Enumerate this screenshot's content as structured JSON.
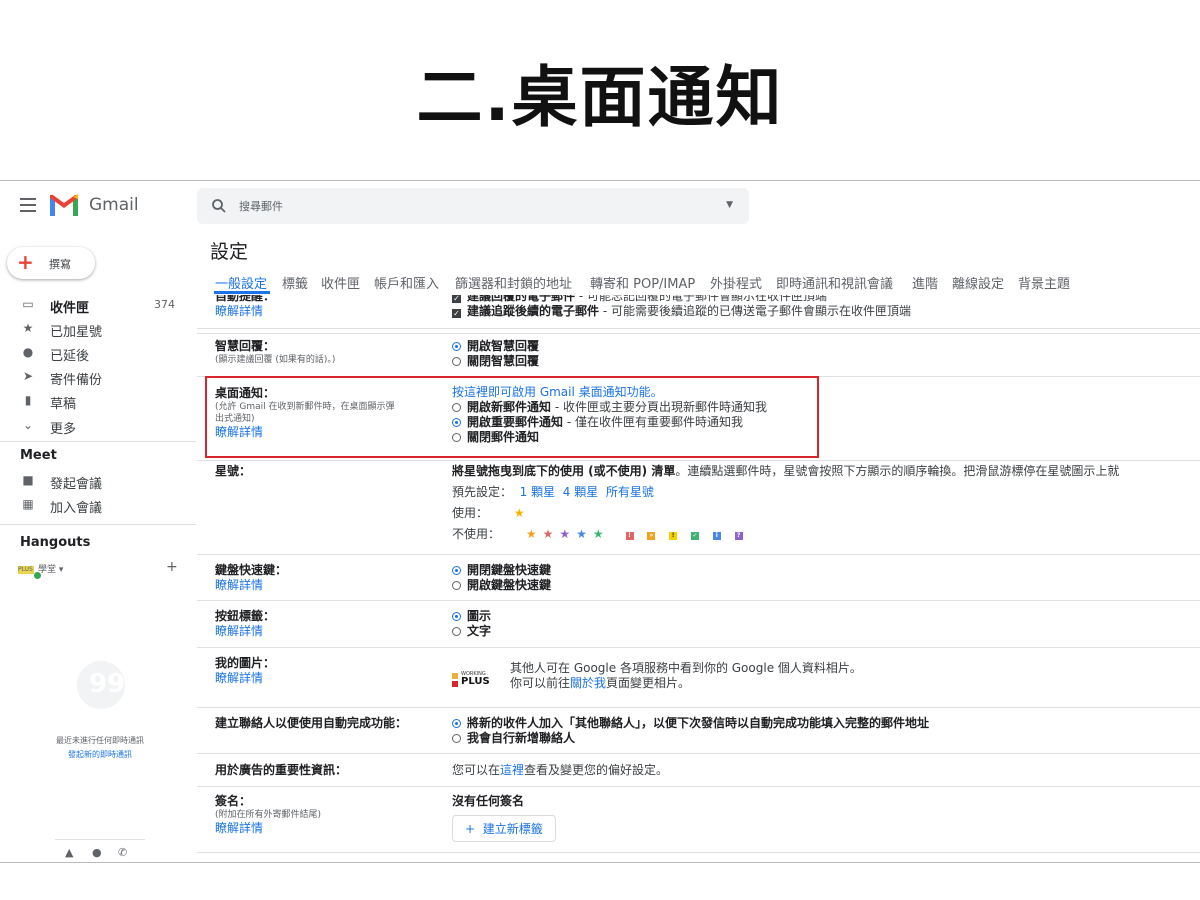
{
  "slide": {
    "title": "二.桌面通知"
  },
  "header": {
    "app_name": "Gmail",
    "search_placeholder": "搜尋郵件"
  },
  "sidebar": {
    "compose_label": "撰寫",
    "items": [
      {
        "label": "收件匣",
        "count": "374",
        "icon": "inbox-icon"
      },
      {
        "label": "已加星號",
        "icon": "star-icon"
      },
      {
        "label": "已延後",
        "icon": "clock-icon"
      },
      {
        "label": "寄件備份",
        "icon": "send-icon"
      },
      {
        "label": "草稿",
        "icon": "draft-icon"
      },
      {
        "label": "更多",
        "icon": "chevron-down-icon"
      }
    ],
    "meet": {
      "heading": "Meet",
      "items": [
        {
          "label": "發起會議"
        },
        {
          "label": "加入會議"
        }
      ]
    },
    "hangouts": {
      "heading": "Hangouts",
      "user": "學堂",
      "avatar_text": "PLUS",
      "empty_text": "最近未進行任何即時通訊",
      "start_link": "發起新的即時通訊"
    }
  },
  "settings": {
    "title": "設定",
    "tabs": [
      "一般設定",
      "標籤",
      "收件匣",
      "帳戶和匯入",
      "篩選器和封鎖的地址",
      "轉寄和 POP/IMAP",
      "外掛程式",
      "即時通訊和視訊會議",
      "進階",
      "離線設定",
      "背景主題"
    ],
    "active_tab": "一般設定",
    "nudges": {
      "label": "自動提醒：",
      "learn_more": "瞭解詳情",
      "opt1_bold": "建議回覆的電子郵件",
      "opt1_desc": " - 可能忘記回覆的電子郵件會顯示在收件匣頂端",
      "opt2_bold": "建議追蹤後續的電子郵件",
      "opt2_desc": " - 可能需要後續追蹤的已傳送電子郵件會顯示在收件匣頂端"
    },
    "smart_reply": {
      "label": "智慧回覆：",
      "sub": "(顯示建議回覆 (如果有的話)。)",
      "opt_on": "開啟智慧回覆",
      "opt_off": "關閉智慧回覆"
    },
    "desktop_notifications": {
      "label": "桌面通知：",
      "sub1": "(允許 Gmail 在收到新郵件時，在桌面顯示彈",
      "sub2": "出式通知)",
      "learn_more": "瞭解詳情",
      "enable_link": "按這裡即可啟用 Gmail 桌面通知功能。",
      "opt_new_bold": "開啟新郵件通知",
      "opt_new_desc": " - 收件匣或主要分頁出現新郵件時通知我",
      "opt_important_bold": "開啟重要郵件通知",
      "opt_important_desc": " - 僅在收件匣有重要郵件時通知我",
      "opt_off_bold": "關閉郵件通知",
      "selected": "important"
    },
    "stars": {
      "label": "星號：",
      "desc_bold": "將星號拖曳到底下的使用 (或不使用) 清單",
      "desc": "。連續點選郵件時，星號會按照下方顯示的順序輪換。把滑鼠游標停在星號圖示上就",
      "presets_label": "預先設定：",
      "preset1": "1 顆星",
      "preset4": "4 顆星",
      "preset_all": "所有星號",
      "in_use_label": "使用：",
      "not_in_use_label": "不使用："
    },
    "shortcuts": {
      "label": "鍵盤快速鍵：",
      "learn_more": "瞭解詳情",
      "opt_on": "開閉鍵盤快速鍵",
      "opt_off": "開啟鍵盤快速鍵"
    },
    "button_labels": {
      "label": "按鈕標籤：",
      "learn_more": "瞭解詳情",
      "opt_icons": "圖示",
      "opt_text": "文字"
    },
    "picture": {
      "label": "我的圖片：",
      "learn_more": "瞭解詳情",
      "line1": "其他人可在 Google 各項服務中看到你的 Google 個人資料相片。",
      "line2_pre": "你可以前往",
      "line2_link": "關於我",
      "line2_post": "頁面變更相片。",
      "logo_top": "WORKING",
      "logo_bottom": "PLUS"
    },
    "autocomplete": {
      "label": "建立聯絡人以便使用自動完成功能：",
      "opt_auto": "將新的收件人加入「其他聯絡人」，以便下次發信時以自動完成功能填入完整的郵件地址",
      "opt_manual": "我會自行新增聯絡人"
    },
    "ads_info": {
      "label": "用於廣告的重要性資訊：",
      "text_pre": "您可以在",
      "text_link": "這裡",
      "text_post": "查看及變更您的偏好設定。"
    },
    "signature": {
      "label": "簽名：",
      "sub": "(附加在所有外寄郵件結尾)",
      "learn_more": "瞭解詳情",
      "none": "沒有任何簽名",
      "new_button": "建立新標籤"
    }
  },
  "colors": {
    "accent": "#1a73e8",
    "highlight": "#d9262c",
    "star": "#f4b400"
  }
}
